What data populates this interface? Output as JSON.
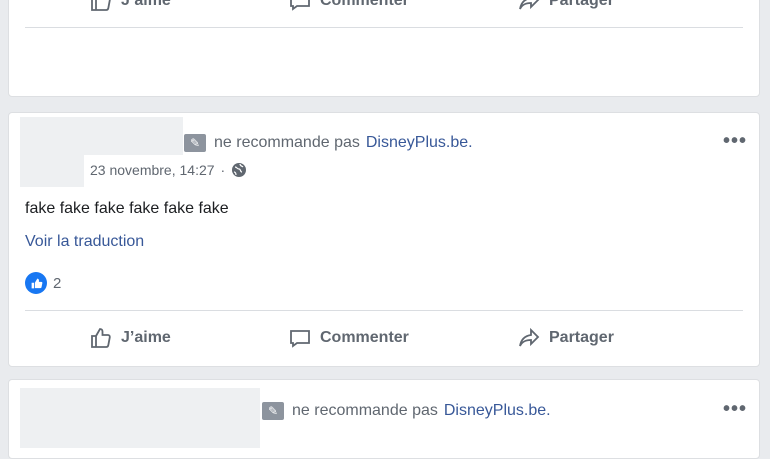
{
  "actions": {
    "like": "J’aime",
    "comment": "Commenter",
    "share": "Partager"
  },
  "review": {
    "recommendation_text": "ne recommande pas",
    "page_name": "DisneyPlus.be.",
    "timestamp": "23 novembre, 14:27",
    "privacy_sep": "·",
    "body": "fake fake fake fake fake fake",
    "translate_label": "Voir la traduction",
    "reaction_count": "2"
  },
  "next_review": {
    "recommendation_text": "ne recommande pas",
    "page_name": "DisneyPlus.be."
  },
  "colors": {
    "link": "#385898",
    "like_blue": "#1877f2",
    "muted": "#606770"
  }
}
